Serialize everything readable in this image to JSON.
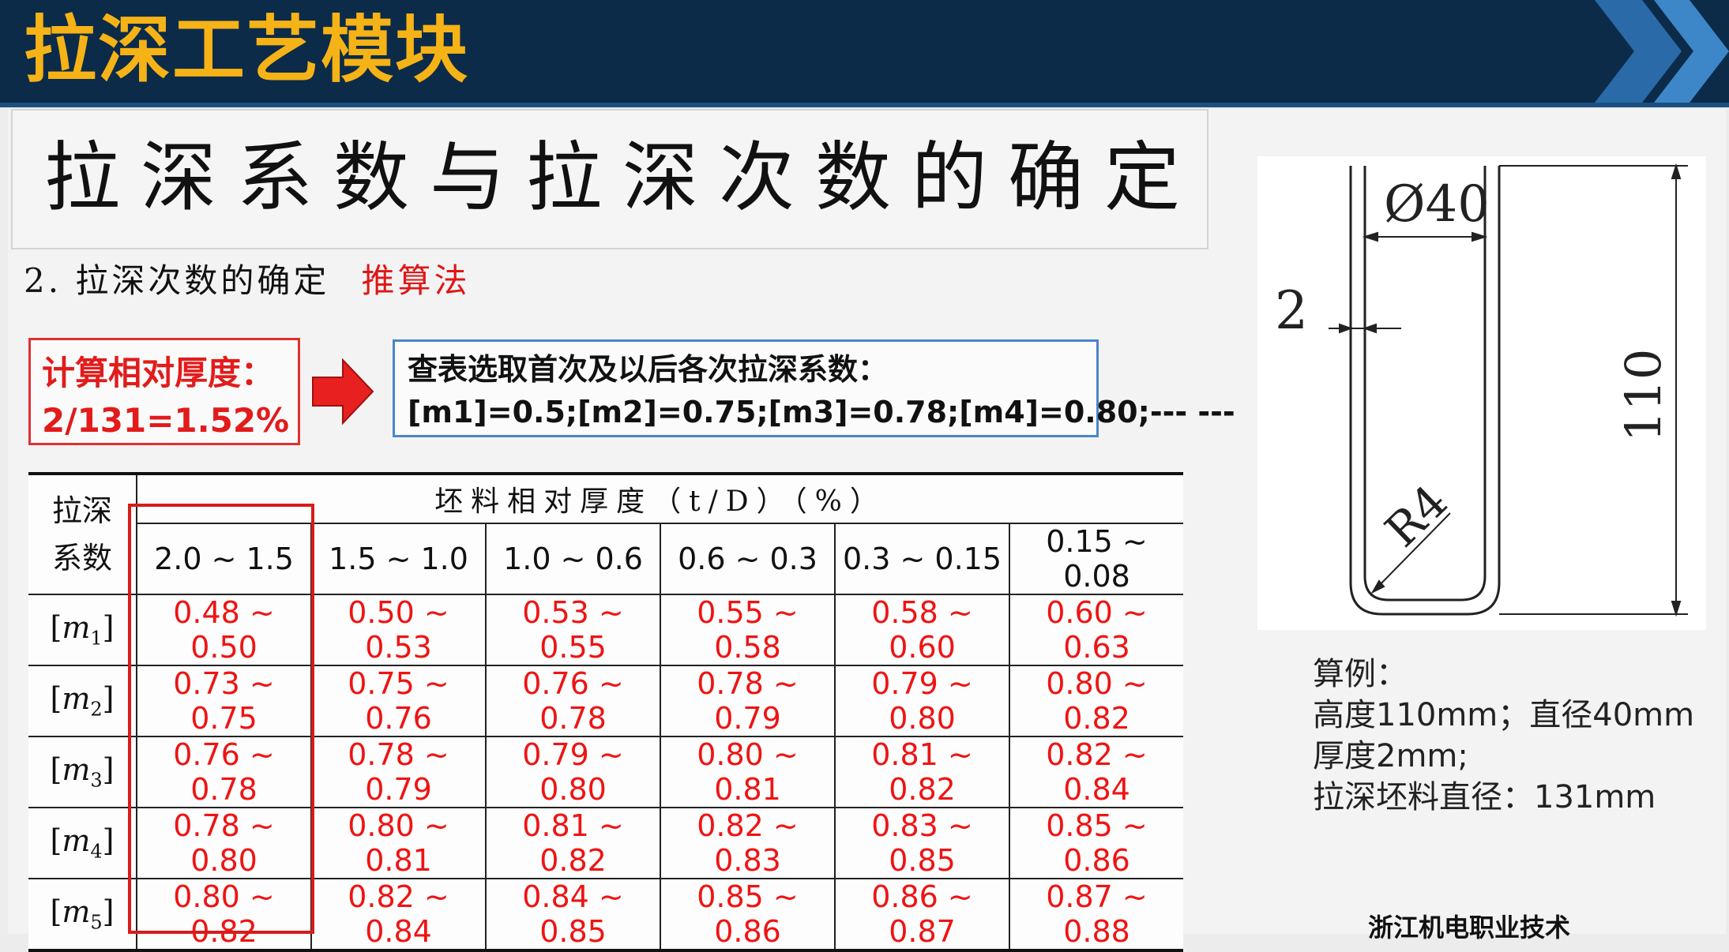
{
  "header": {
    "title": "拉深工艺模块"
  },
  "slide": {
    "title": "拉深系数与拉深次数的确定",
    "section": "2. 拉深次数的确定",
    "method": "推算法"
  },
  "calc": {
    "line1": "计算相对厚度：",
    "line2": "2/131=1.52%"
  },
  "lookup": {
    "line1": "查表选取首次及以后各次拉深系数：",
    "line2": "[m1]=0.5;[m2]=0.75;[m3]=0.78;[m4]=0.80;--- ---"
  },
  "table": {
    "corner_line1": "拉深",
    "corner_line2": "系数",
    "group_header": "坯料相对厚度（t/D）（%）",
    "columns": [
      "2.0 ~ 1.5",
      "1.5 ~ 1.0",
      "1.0 ~ 0.6",
      "0.6 ~ 0.3",
      "0.3 ~ 0.15",
      "0.15 ~ 0.08"
    ],
    "rows": [
      {
        "m": "m",
        "sub": "1",
        "values": [
          "0.48 ~ 0.50",
          "0.50 ~ 0.53",
          "0.53 ~ 0.55",
          "0.55 ~ 0.58",
          "0.58 ~ 0.60",
          "0.60 ~ 0.63"
        ]
      },
      {
        "m": "m",
        "sub": "2",
        "values": [
          "0.73 ~ 0.75",
          "0.75 ~ 0.76",
          "0.76 ~ 0.78",
          "0.78 ~ 0.79",
          "0.79 ~ 0.80",
          "0.80 ~ 0.82"
        ]
      },
      {
        "m": "m",
        "sub": "3",
        "values": [
          "0.76 ~ 0.78",
          "0.78 ~ 0.79",
          "0.79 ~ 0.80",
          "0.80 ~ 0.81",
          "0.81 ~ 0.82",
          "0.82 ~ 0.84"
        ]
      },
      {
        "m": "m",
        "sub": "4",
        "values": [
          "0.78 ~ 0.80",
          "0.80 ~ 0.81",
          "0.81 ~ 0.82",
          "0.82 ~ 0.83",
          "0.83 ~ 0.85",
          "0.85 ~ 0.86"
        ]
      },
      {
        "m": "m",
        "sub": "5",
        "values": [
          "0.80 ~ 0.82",
          "0.82 ~ 0.84",
          "0.84 ~ 0.85",
          "0.85 ~ 0.86",
          "0.86 ~ 0.87",
          "0.87 ~ 0.88"
        ]
      }
    ]
  },
  "drawing": {
    "diameter": "Ø40",
    "thickness": "2",
    "height": "110",
    "radius": "R4"
  },
  "example": {
    "label": "算例：",
    "line1": "高度110mm；直径40mm",
    "line2": "厚度2mm;",
    "line3": "拉深坯料直径：131mm"
  },
  "footer": {
    "logo_text": "浙江机电职业技术"
  },
  "colors": {
    "banner": "#0c2b49",
    "title_accent": "#f5b317",
    "highlight_red": "#e01616",
    "box_blue": "#4a86c8"
  }
}
